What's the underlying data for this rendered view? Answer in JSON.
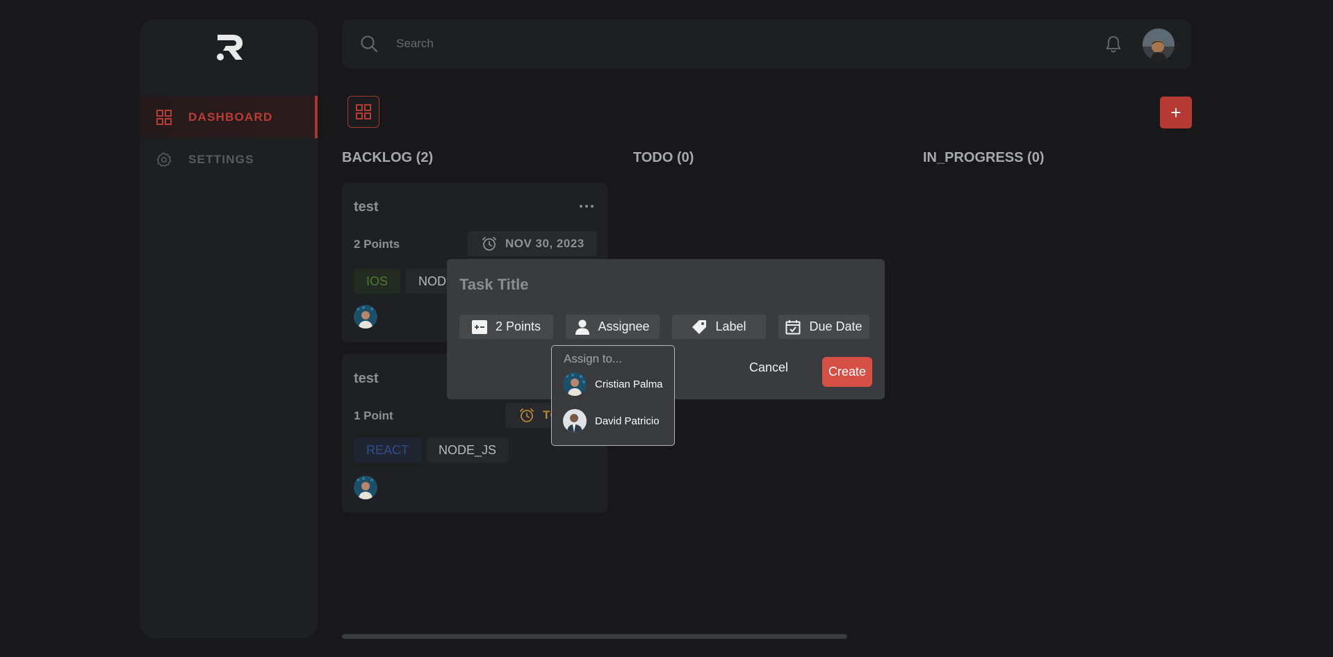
{
  "sidebar": {
    "logo": "R-logo",
    "items": [
      {
        "label": "DASHBOARD",
        "icon": "grid-icon",
        "active": true
      },
      {
        "label": "SETTINGS",
        "icon": "gear-icon",
        "active": false
      }
    ]
  },
  "header": {
    "search_placeholder": "Search",
    "icons": [
      "search-icon",
      "bell-icon"
    ]
  },
  "toolbar": {
    "add_label": "+"
  },
  "board": {
    "columns": [
      {
        "title": "BACKLOG (2)"
      },
      {
        "title": "TODO (0)"
      },
      {
        "title": "IN_PROGRESS (0)"
      }
    ],
    "cards": [
      {
        "title": "test",
        "points": "2 Points",
        "date": "NOV 30, 2023",
        "tags": [
          {
            "label": "IOS",
            "color": "#4f7a34"
          },
          {
            "label": "NODE_JS",
            "color": "#b9babe"
          }
        ]
      },
      {
        "title": "test",
        "points": "1 Point",
        "date": "TODAY",
        "date_color": "#b8862f",
        "tags": [
          {
            "label": "REACT",
            "color": "#2d4d8e"
          },
          {
            "label": "NODE_JS",
            "color": "#b9babe"
          }
        ]
      }
    ]
  },
  "modal": {
    "title_placeholder": "Task Title",
    "points_label": "2 Points",
    "assignee_label": "Assignee",
    "label_label": "Label",
    "due_date_label": "Due Date",
    "cancel_label": "Cancel",
    "create_label": "Create",
    "accent": "#d64f45"
  },
  "assign_dropdown": {
    "header": "Assign to...",
    "users": [
      {
        "name": "Cristian Palma"
      },
      {
        "name": "David Patricio"
      }
    ]
  },
  "colors": {
    "background": "#18181b",
    "panel": "#1e1f22",
    "accent": "#b53a34"
  }
}
